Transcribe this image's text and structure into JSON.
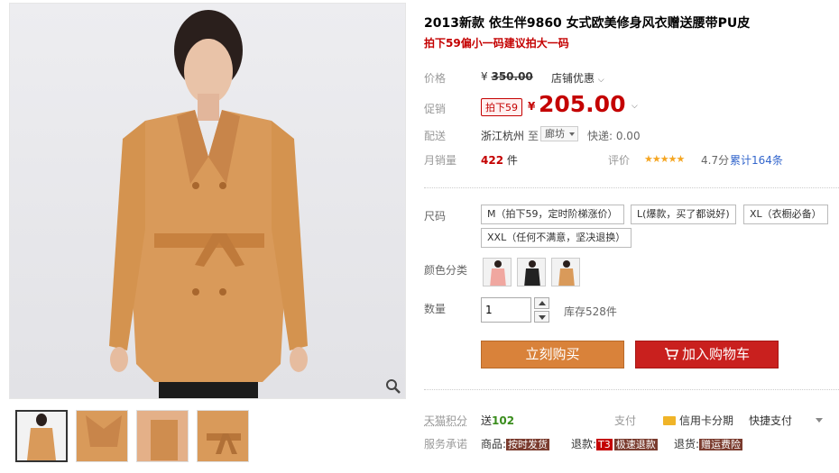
{
  "product": {
    "title": "2013新款 依生伴9860 女式欧美修身风衣赠送腰带PU皮",
    "subtitle": "拍下59偏小一码建议拍大一码"
  },
  "price": {
    "label": "价格",
    "original": "350.00",
    "currency": "¥",
    "shop_discount": "店铺优惠"
  },
  "promo": {
    "label": "促销",
    "tag": "拍下59",
    "currency": "¥",
    "price": "205.00"
  },
  "delivery": {
    "label": "配送",
    "from": "浙江杭州",
    "to_word": "至",
    "destination": "廊坊",
    "express": "快递: 0.00"
  },
  "sales": {
    "label": "月销量",
    "count": "422",
    "unit": "件",
    "rating_label": "评价",
    "stars": "★★★★★",
    "score": "4.7分",
    "total": "累计164条"
  },
  "size": {
    "label": "尺码",
    "options": [
      "M（拍下59，定时阶梯涨价）",
      "L(爆款，买了都说好)",
      "XL（衣橱必备）",
      "XXL（任何不满意，坚决退换）"
    ]
  },
  "color": {
    "label": "颜色分类",
    "swatches": [
      "pink",
      "black",
      "orange"
    ]
  },
  "quantity": {
    "label": "数量",
    "value": "1",
    "stock": "库存528件"
  },
  "buttons": {
    "buy_now": "立刻购买",
    "add_to_cart": "加入购物车"
  },
  "footer": {
    "points_label": "天猫积分",
    "points_prefix": "送",
    "points_value": "102",
    "pay_label": "支付",
    "credit_installment": "信用卡分期",
    "quick_pay": "快捷支付",
    "promise_label": "服务承诺",
    "goods_prefix": "商品:",
    "goods_badge": "按时发货",
    "refund_prefix": "退款:",
    "refund_t3": "T3",
    "refund_badge": "极速退款",
    "return_prefix": "退货:",
    "return_badge": "赠运费险"
  },
  "colors": {
    "accent_red": "#c40000",
    "buy_orange": "#d9823a",
    "cart_red": "#c9201e",
    "coat": "#d99a5a"
  }
}
